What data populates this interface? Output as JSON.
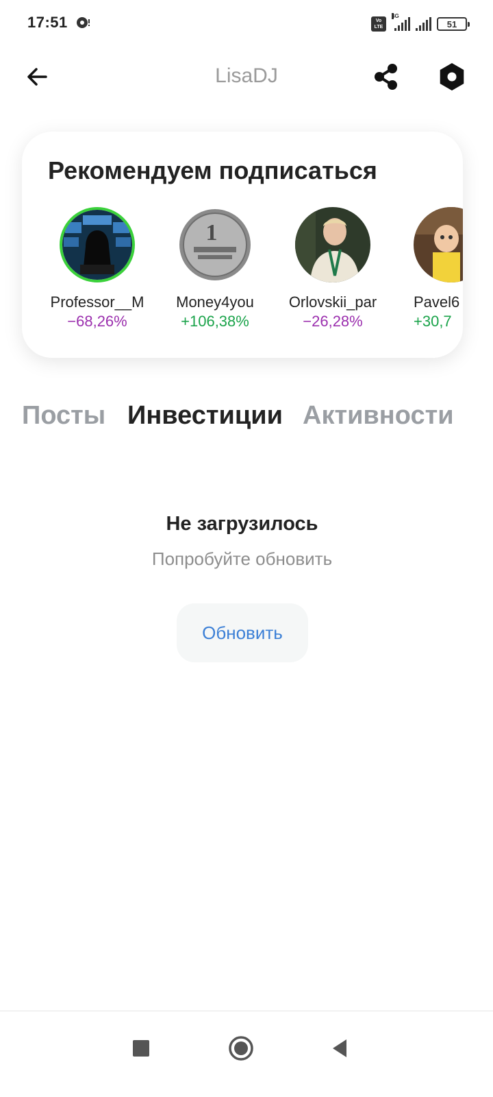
{
  "status_bar": {
    "time": "17:51",
    "notification_icon": "record-icon",
    "volte_label": "Vo\nLTE",
    "network_label": "4G",
    "battery_level": "51"
  },
  "app_bar": {
    "title": "LisaDJ",
    "back_icon": "arrow-left-icon",
    "share_icon": "share-icon",
    "settings_icon": "hexagon-settings-icon"
  },
  "recommendations": {
    "title": "Рекомендуем подписаться",
    "items": [
      {
        "name": "Professor__M",
        "change": "−68,26%",
        "trend": "negative",
        "avatar_hint": "hacker-monitors"
      },
      {
        "name": "Money4you",
        "change": "+106,38%",
        "trend": "positive",
        "avatar_hint": "coin"
      },
      {
        "name": "Orlovskii_par",
        "change": "−26,28%",
        "trend": "negative",
        "avatar_hint": "man-portrait"
      },
      {
        "name": "Pavel6",
        "change": "+30,7",
        "trend": "positive",
        "avatar_hint": "child"
      }
    ]
  },
  "tabs": [
    {
      "label": "Посты",
      "active": false
    },
    {
      "label": "Инвестиции",
      "active": true
    },
    {
      "label": "Активности",
      "active": false
    }
  ],
  "empty_state": {
    "title": "Не загрузилось",
    "subtitle": "Попробуйте обновить",
    "button_label": "Обновить"
  },
  "colors": {
    "negative": "#9b2fae",
    "positive": "#1aa34a",
    "link_blue": "#3b7fd6",
    "muted_gray": "#9a9ea3"
  },
  "nav_bar": {
    "recents_icon": "square-icon",
    "home_icon": "circle-home-icon",
    "back_icon": "triangle-back-icon"
  }
}
